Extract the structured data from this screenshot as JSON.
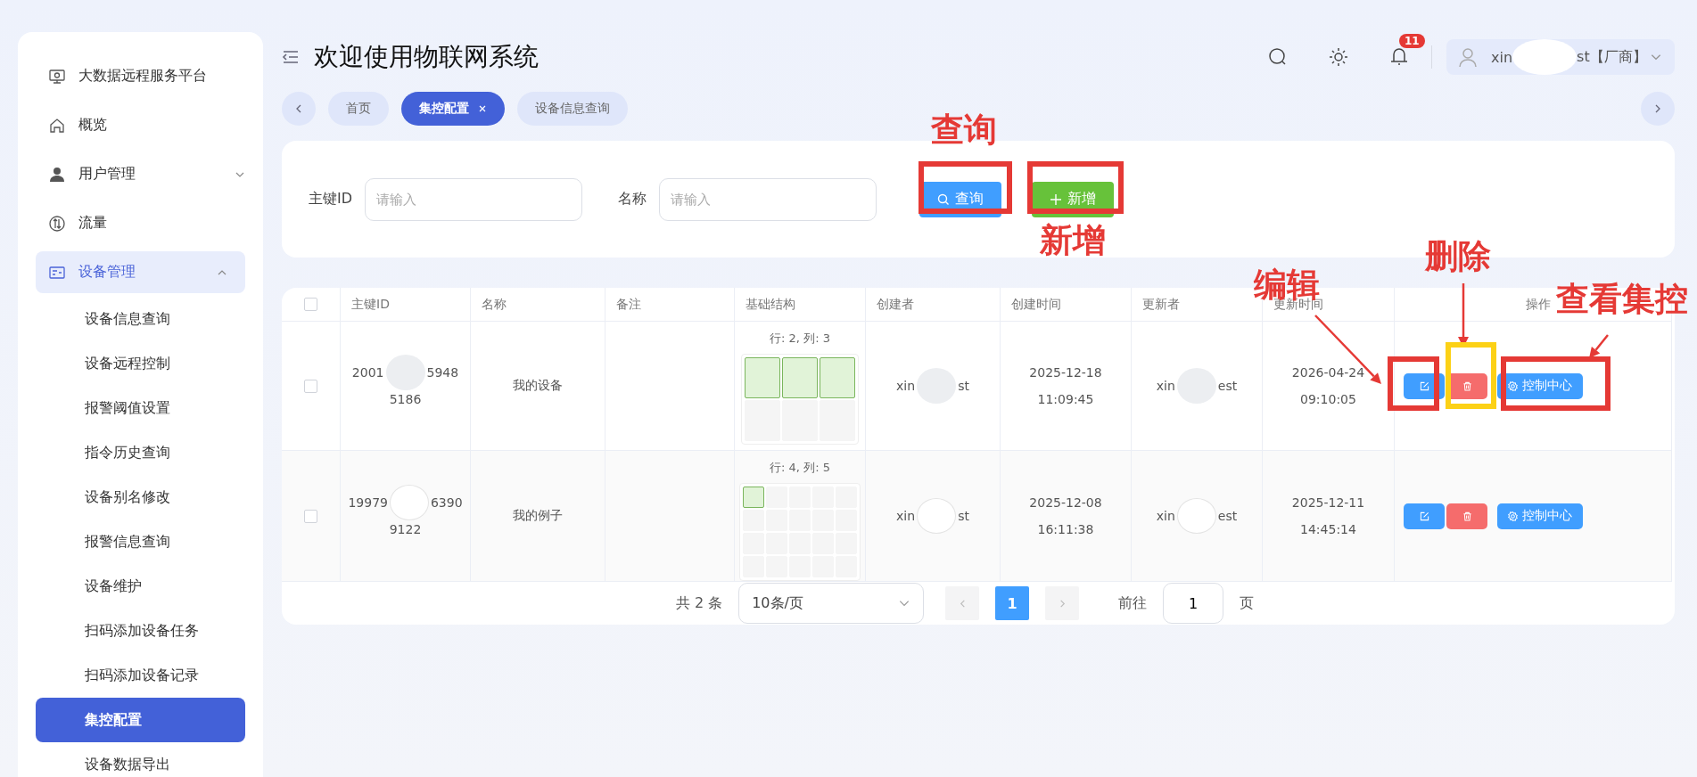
{
  "sidebar": {
    "items": [
      {
        "label": "大数据远程服务平台"
      },
      {
        "label": "概览"
      },
      {
        "label": "用户管理",
        "expanded": false
      },
      {
        "label": "流量"
      },
      {
        "label": "设备管理",
        "expanded": true,
        "children": [
          {
            "label": "设备信息查询",
            "selected": false
          },
          {
            "label": "设备远程控制",
            "selected": false
          },
          {
            "label": "报警阈值设置",
            "selected": false
          },
          {
            "label": "指令历史查询",
            "selected": false
          },
          {
            "label": "设备别名修改",
            "selected": false
          },
          {
            "label": "报警信息查询",
            "selected": false
          },
          {
            "label": "设备维护",
            "selected": false
          },
          {
            "label": "扫码添加设备任务",
            "selected": false
          },
          {
            "label": "扫码添加设备记录",
            "selected": false
          },
          {
            "label": "集控配置",
            "selected": true
          },
          {
            "label": "设备数据导出",
            "selected": false
          }
        ]
      }
    ]
  },
  "header": {
    "title": "欢迎使用物联网系统",
    "notifications": "11",
    "user": {
      "name_start": "xin",
      "name_end": "st【厂商】"
    }
  },
  "tabs": [
    {
      "label": "首页",
      "selected": false,
      "closable": false
    },
    {
      "label": "集控配置",
      "selected": true,
      "closable": true
    },
    {
      "label": "设备信息查询",
      "selected": false,
      "closable": false
    }
  ],
  "search": {
    "fields": [
      {
        "label": "主键ID",
        "placeholder": "请输入"
      },
      {
        "label": "名称",
        "placeholder": "请输入"
      }
    ],
    "buttons": [
      {
        "label": "查询",
        "kind": "search"
      },
      {
        "label": "新增",
        "kind": "add"
      }
    ]
  },
  "table": {
    "all_checked": false,
    "columns": [
      "主键ID",
      "名称",
      "备注",
      "基础结构",
      "创建者",
      "创建时间",
      "更新者",
      "更新时间",
      "操作"
    ],
    "rows": [
      {
        "checked": false,
        "id": {
          "start": "2001",
          "end": "5948",
          "line2": "5186"
        },
        "name": "我的设备",
        "structure": {
          "label": "行: 2, 列: 3",
          "grid": [
            [
              {
                "selected": true
              },
              {
                "selected": true
              },
              {
                "selected": true
              }
            ],
            [
              {
                "selected": false
              },
              {
                "selected": false
              },
              {
                "selected": false
              }
            ]
          ]
        },
        "creator": {
          "start": "xin",
          "end": "st"
        },
        "created": [
          "2025-12-18",
          "11:09:45"
        ],
        "updater": {
          "start": "xin",
          "end": "est"
        },
        "updated": [
          "2026-04-24",
          "09:10:05"
        ],
        "actions": [
          {
            "kind": "edit"
          },
          {
            "kind": "delete"
          },
          {
            "kind": "control",
            "label": "控制中心"
          }
        ]
      },
      {
        "checked": false,
        "id": {
          "start": "19979",
          "end": "6390",
          "line2": "9122"
        },
        "name": "我的例子",
        "structure": {
          "label": "行: 4, 列: 5",
          "grid": [
            [
              {
                "selected": true
              },
              {
                "selected": false
              },
              {
                "selected": false
              },
              {
                "selected": false
              },
              {
                "selected": false
              }
            ],
            [
              {
                "selected": false
              },
              {
                "selected": false
              },
              {
                "selected": false
              },
              {
                "selected": false
              },
              {
                "selected": false
              }
            ],
            [
              {
                "selected": false
              },
              {
                "selected": false
              },
              {
                "selected": false
              },
              {
                "selected": false
              },
              {
                "selected": false
              }
            ],
            [
              {
                "selected": false
              },
              {
                "selected": false
              },
              {
                "selected": false
              },
              {
                "selected": false
              },
              {
                "selected": false
              }
            ]
          ]
        },
        "creator": {
          "start": "xin",
          "end": "st"
        },
        "created": [
          "2025-12-08",
          "16:11:38"
        ],
        "updater": {
          "start": "xin",
          "end": "est"
        },
        "updated": [
          "2025-12-11",
          "14:45:14"
        ],
        "actions": [
          {
            "kind": "edit"
          },
          {
            "kind": "delete"
          },
          {
            "kind": "control",
            "label": "控制中心"
          }
        ]
      }
    ]
  },
  "pagination": {
    "total": "共 2 条",
    "page_size": "10条/页",
    "pages": [
      {
        "label": "1",
        "selected": true
      }
    ],
    "goto_label": "前往",
    "goto_value": "1",
    "goto_suffix": "页"
  },
  "annotations": [
    {
      "kind": "label",
      "text": "查询"
    },
    {
      "kind": "box",
      "color": "#e53935"
    },
    {
      "kind": "box",
      "color": "#e53935"
    },
    {
      "kind": "label",
      "text": "新增"
    },
    {
      "kind": "label",
      "text": "编辑"
    },
    {
      "kind": "arrow"
    },
    {
      "kind": "box",
      "color": "#e53935"
    },
    {
      "kind": "label",
      "text": "删除"
    },
    {
      "kind": "arrow"
    },
    {
      "kind": "box",
      "color": "#fcd116"
    },
    {
      "kind": "label",
      "text": "查看集控"
    },
    {
      "kind": "arrow"
    },
    {
      "kind": "box",
      "color": "#e53935"
    }
  ]
}
